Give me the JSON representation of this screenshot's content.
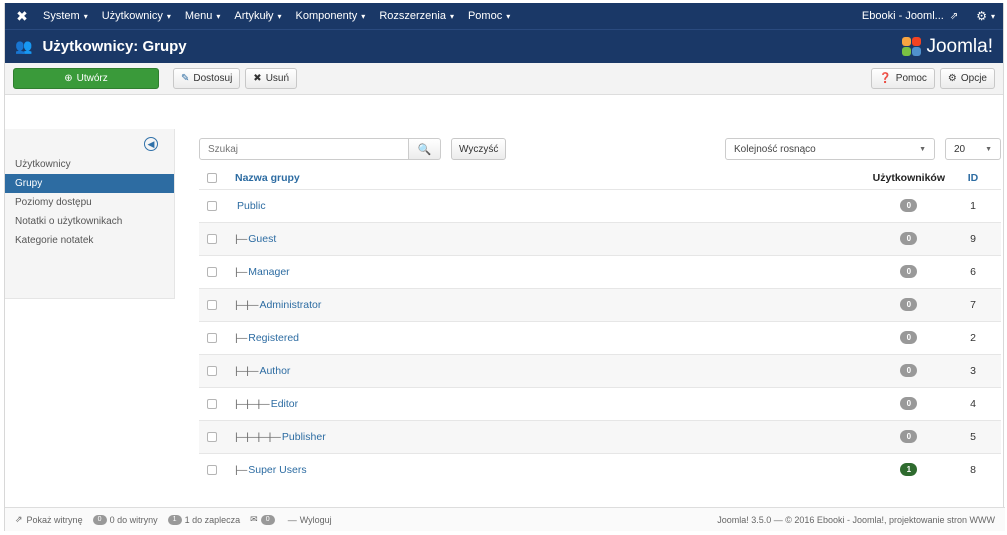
{
  "navbar": {
    "menus": [
      {
        "label": "System",
        "name": "menu-system"
      },
      {
        "label": "Użytkownicy",
        "name": "menu-users"
      },
      {
        "label": "Menu",
        "name": "menu-menu"
      },
      {
        "label": "Artykuły",
        "name": "menu-articles"
      },
      {
        "label": "Komponenty",
        "name": "menu-components"
      },
      {
        "label": "Rozszerzenia",
        "name": "menu-extensions"
      },
      {
        "label": "Pomoc",
        "name": "menu-help"
      }
    ],
    "site_name": "Ebooki - Jooml...",
    "logo_icon": "joomla-x-icon",
    "external_icon": "external-link-icon",
    "user_icon": "gear-icon"
  },
  "header": {
    "title": "Użytkownicy: Grupy",
    "brand": "Joomla!",
    "title_icon": "users-icon"
  },
  "toolbar": {
    "new_label": "Utwórz",
    "edit_label": "Dostosuj",
    "delete_label": "Usuń",
    "help_label": "Pomoc",
    "options_label": "Opcje"
  },
  "sidebar": {
    "items": [
      {
        "label": "Użytkownicy",
        "active": false
      },
      {
        "label": "Grupy",
        "active": true
      },
      {
        "label": "Poziomy dostępu",
        "active": false
      },
      {
        "label": "Notatki o użytkownikach",
        "active": false
      },
      {
        "label": "Kategorie notatek",
        "active": false
      }
    ]
  },
  "filters": {
    "search_placeholder": "Szukaj",
    "clear_label": "Wyczyść",
    "sort_value": "Kolejność rosnąco",
    "limit_value": "20"
  },
  "table": {
    "headers": {
      "name": "Nazwa grupy",
      "users": "Użytkowników",
      "id": "ID"
    },
    "rows": [
      {
        "prefix": "",
        "name": "Public",
        "users": "0",
        "id": "1",
        "badge": "grey"
      },
      {
        "prefix": "|—",
        "name": "Guest",
        "users": "0",
        "id": "9",
        "badge": "grey"
      },
      {
        "prefix": "|—",
        "name": "Manager",
        "users": "0",
        "id": "6",
        "badge": "grey"
      },
      {
        "prefix": "|—|—",
        "name": "Administrator",
        "users": "0",
        "id": "7",
        "badge": "grey"
      },
      {
        "prefix": "|—",
        "name": "Registered",
        "users": "0",
        "id": "2",
        "badge": "grey"
      },
      {
        "prefix": "|—|—",
        "name": "Author",
        "users": "0",
        "id": "3",
        "badge": "grey"
      },
      {
        "prefix": "|—|—|—",
        "name": "Editor",
        "users": "0",
        "id": "4",
        "badge": "grey"
      },
      {
        "prefix": "|—|—|—|—",
        "name": "Publisher",
        "users": "0",
        "id": "5",
        "badge": "grey"
      },
      {
        "prefix": "|—",
        "name": "Super Users",
        "users": "1",
        "id": "8",
        "badge": "green"
      }
    ]
  },
  "footer": {
    "view_site": "Pokaż witrynę",
    "visitors_count": "0",
    "visitors_label": "0 do witryny",
    "admins_count": "1",
    "admins_label": "1 do zaplecza",
    "messages_count": "0",
    "logout": "Wyloguj",
    "copyright": "Joomla! 3.5.0 — © 2016 Ebooki - Joomla!, projektowanie stron WWW"
  },
  "colors": {
    "navbar_bg": "#1a3867",
    "success": "#3a9a3a",
    "link": "#2d6ca2",
    "badge_grey": "#999999",
    "badge_green": "#2f6b2f"
  }
}
